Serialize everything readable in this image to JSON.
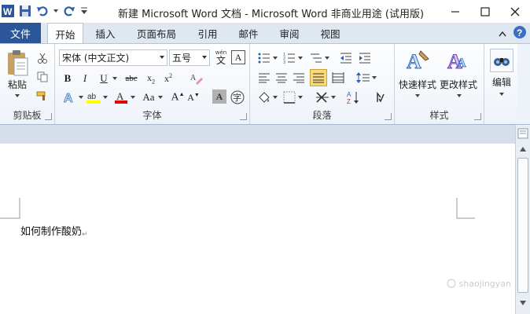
{
  "titlebar": {
    "title": "新建 Microsoft Word 文档  -  Microsoft Word 非商业用途 (试用版)"
  },
  "tabs": {
    "file": "文件",
    "items": [
      "开始",
      "插入",
      "页面布局",
      "引用",
      "邮件",
      "审阅",
      "视图"
    ],
    "active_index": 0
  },
  "ribbon": {
    "clipboard": {
      "label": "剪贴板",
      "paste": "粘贴"
    },
    "font": {
      "label": "字体",
      "font_name": "宋体 (中文正文)",
      "font_size": "五号",
      "wen_glyph": "wén"
    },
    "paragraph": {
      "label": "段落"
    },
    "styles": {
      "label": "样式",
      "quick_styles": "快速样式",
      "change_styles": "更改样式"
    },
    "editing": {
      "label": "编辑",
      "button": "编辑"
    }
  },
  "document": {
    "text": "如何制作酸奶"
  },
  "watermark": "shaojingyan",
  "colors": {
    "file_tab": "#2b579a",
    "highlight_yellow": "#ffff00",
    "font_red": "#e00000",
    "active_align": "#f9d97a"
  }
}
